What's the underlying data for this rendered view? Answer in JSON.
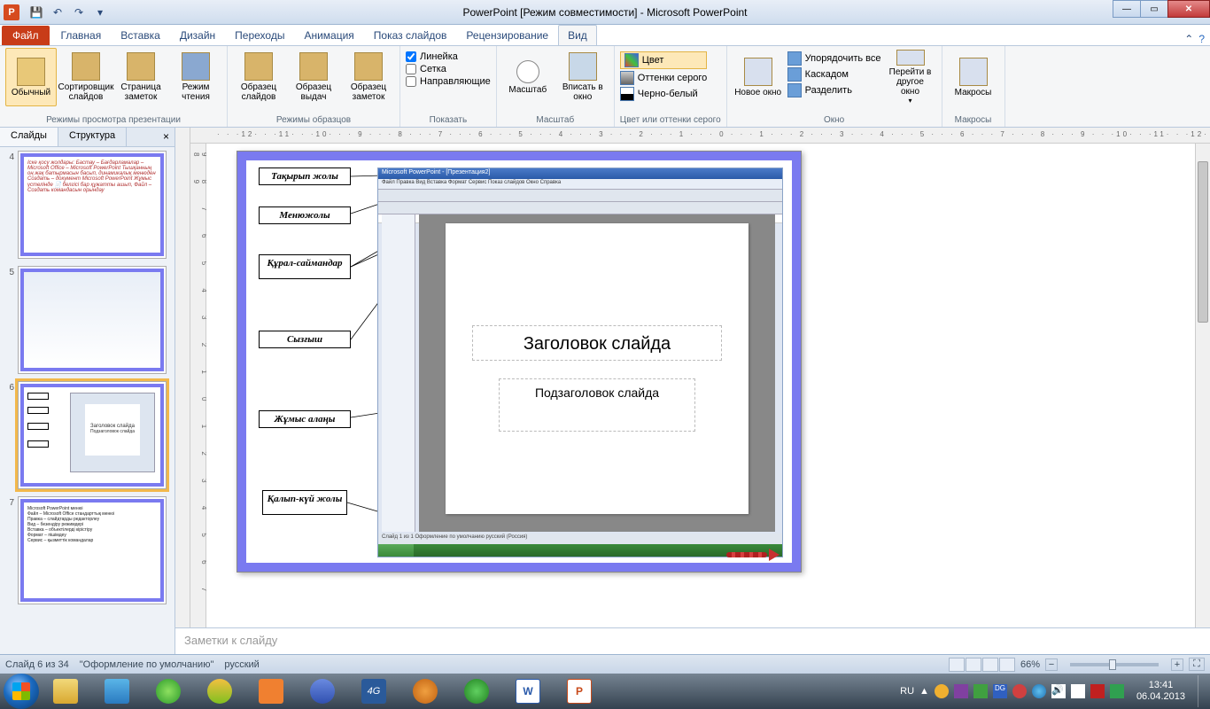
{
  "titlebar": {
    "title": "PowerPoint [Режим совместимости]  -  Microsoft PowerPoint"
  },
  "tabs": {
    "file": "Файл",
    "items": [
      "Главная",
      "Вставка",
      "Дизайн",
      "Переходы",
      "Анимация",
      "Показ слайдов",
      "Рецензирование",
      "Вид"
    ],
    "active_index": 7
  },
  "ribbon": {
    "views_group": {
      "label": "Режимы просмотра презентации",
      "normal": "Обычный",
      "sorter": "Сортировщик слайдов",
      "notes_page": "Страница заметок",
      "reading": "Режим чтения"
    },
    "master_group": {
      "label": "Режимы образцов",
      "slide_master": "Образец слайдов",
      "handout_master": "Образец выдач",
      "notes_master": "Образец заметок"
    },
    "show_group": {
      "label": "Показать",
      "ruler": "Линейка",
      "gridlines": "Сетка",
      "guides": "Направляющие"
    },
    "zoom_group": {
      "label": "Масштаб",
      "zoom": "Масштаб",
      "fit": "Вписать в окно"
    },
    "color_group": {
      "label": "Цвет или оттенки серого",
      "color": "Цвет",
      "grayscale": "Оттенки серого",
      "bw": "Черно-белый"
    },
    "window_group": {
      "label": "Окно",
      "new_window": "Новое окно",
      "arrange": "Упорядочить все",
      "cascade": "Каскадом",
      "split": "Разделить",
      "switch": "Перейти в другое окно"
    },
    "macros_group": {
      "label": "Макросы",
      "macros": "Макросы"
    }
  },
  "left_panel": {
    "tab_slides": "Слайды",
    "tab_outline": "Структура",
    "thumbs": [
      {
        "num": "4",
        "text": "Іске қосу жолдары:\nБастау – Бағдарламалар – Microsoft Office – Microsoft PowerPoint\nТышқанның оң жақ батырмасын басып, динамикалық менюден Создать – документ Microsoft PowerPoint\nЖұмыс үстелінде 📄 белгісі бар құжатты ашып, Файл – Создать командасын орындау"
      },
      {
        "num": "5",
        "text": ""
      },
      {
        "num": "6",
        "text": ""
      },
      {
        "num": "7",
        "text": "Microsoft PowerPoint менюі"
      }
    ],
    "selected": 2
  },
  "slide": {
    "callouts": {
      "title_bar": "Тақырып жолы",
      "menu_bar": "Менюжолы",
      "toolbars": "Құрал-саймандар",
      "ruler": "Сызғыш",
      "work_area": "Жұмыс алаңы",
      "status_bar": "Қалып-күй жолы"
    },
    "mock": {
      "app_title": "Microsoft PowerPoint - [Презентация2]",
      "menu": "Файл  Правка  Вид  Вставка  Формат  Сервис  Показ слайдов  Окно  Справка",
      "slide_title": "Заголовок слайда",
      "slide_subtitle": "Подзаголовок слайда",
      "status": "Слайд 1 из 1        Оформление по умолчанию        русский (Россия)"
    }
  },
  "notes": {
    "placeholder": "Заметки к слайду"
  },
  "status": {
    "slide_of": "Слайд 6 из 34",
    "theme": "\"Оформление по умолчанию\"",
    "lang": "русский",
    "zoom": "66%"
  },
  "taskbar": {
    "lang": "RU",
    "time": "13:41",
    "date": "06.04.2013"
  }
}
